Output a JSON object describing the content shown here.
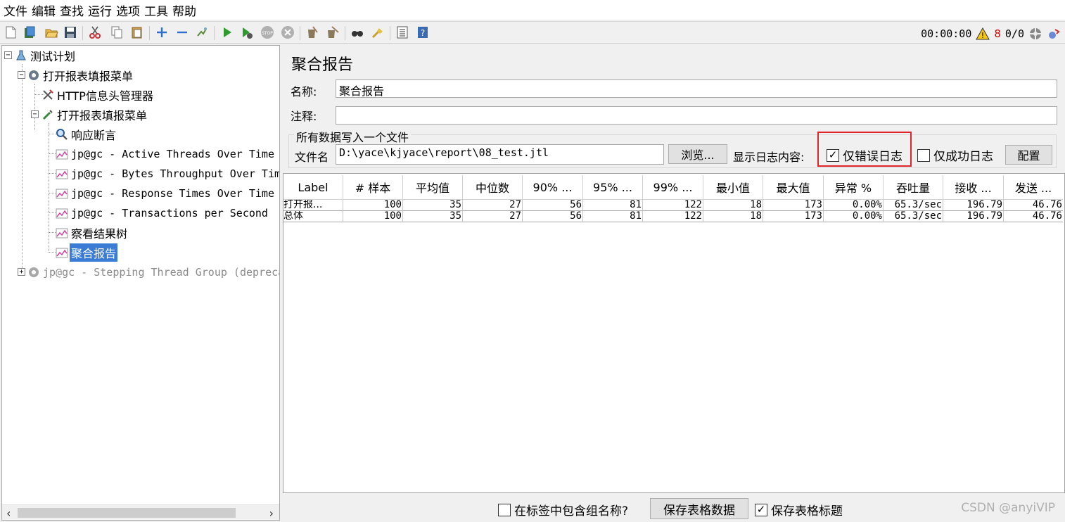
{
  "menu": [
    "文件",
    "编辑",
    "查找",
    "运行",
    "选项",
    "工具",
    "帮助"
  ],
  "toolbar": {
    "icons": [
      "new-icon",
      "templates-icon",
      "open-icon",
      "save-icon",
      "cut-icon",
      "copy-icon",
      "paste-icon",
      "expand-icon",
      "collapse-icon",
      "toggle-icon",
      "start-icon",
      "start-no-pause-icon",
      "stop-icon",
      "shutdown-icon",
      "clear-icon",
      "clear-all-icon",
      "search-icon",
      "reset-search-icon",
      "function-helper-icon",
      "help-icon"
    ],
    "timer": "00:00:00",
    "warning_count": "8",
    "threads": "0/0"
  },
  "tree": {
    "items": [
      {
        "label": "测试计划",
        "icon": "flask-icon"
      },
      {
        "label": "打开报表填报菜单",
        "icon": "gear-icon"
      },
      {
        "label": "HTTP信息头管理器",
        "icon": "wrench-icon"
      },
      {
        "label": "打开报表填报菜单",
        "icon": "pipette-icon"
      },
      {
        "label": "响应断言",
        "icon": "magnifier-icon"
      },
      {
        "label": "jp@gc - Active Threads Over Time",
        "icon": "graph-icon"
      },
      {
        "label": "jp@gc - Bytes Throughput Over Time",
        "icon": "graph-icon"
      },
      {
        "label": "jp@gc - Response Times Over Time",
        "icon": "graph-icon"
      },
      {
        "label": "jp@gc - Transactions per Second",
        "icon": "graph-icon"
      },
      {
        "label": "察看结果树",
        "icon": "graph-icon"
      },
      {
        "label": "聚合报告",
        "icon": "graph-icon"
      },
      {
        "label": "jp@gc - Stepping Thread Group (deprecated)",
        "icon": "gear-icon"
      }
    ]
  },
  "panel": {
    "title": "聚合报告",
    "name_label": "名称:",
    "name_value": "聚合报告",
    "comment_label": "注释:",
    "comment_value": "",
    "file_group_title": "所有数据写入一个文件",
    "filename_label": "文件名",
    "filename_value": "D:\\yace\\kjyace\\report\\08_test.jtl",
    "browse_label": "浏览...",
    "log_display_label": "显示日志内容:",
    "errors_only_label": "仅错误日志",
    "errors_only_checked": true,
    "success_only_label": "仅成功日志",
    "success_only_checked": false,
    "configure_label": "配置"
  },
  "table": {
    "columns": [
      "Label",
      "# 样本",
      "平均值",
      "中位数",
      "90% ...",
      "95% ...",
      "99% ...",
      "最小值",
      "最大值",
      "异常 %",
      "吞吐量",
      "接收 ...",
      "发送 ..."
    ],
    "rows": [
      [
        "打开报...",
        "100",
        "35",
        "27",
        "56",
        "81",
        "122",
        "18",
        "173",
        "0.00%",
        "65.3/sec",
        "196.79",
        "46.76"
      ],
      [
        "总体",
        "100",
        "35",
        "27",
        "56",
        "81",
        "122",
        "18",
        "173",
        "0.00%",
        "65.3/sec",
        "196.79",
        "46.76"
      ]
    ]
  },
  "bottom": {
    "include_group_label": "在标签中包含组名称?",
    "include_group_checked": false,
    "save_table_label": "保存表格数据",
    "save_header_label": "保存表格标题",
    "save_header_checked": true,
    "watermark": "CSDN @anyiVIP"
  },
  "colors": {
    "selection": "#3a7bd5",
    "highlight_box": "#e0262b",
    "warning": "#cc0000"
  }
}
